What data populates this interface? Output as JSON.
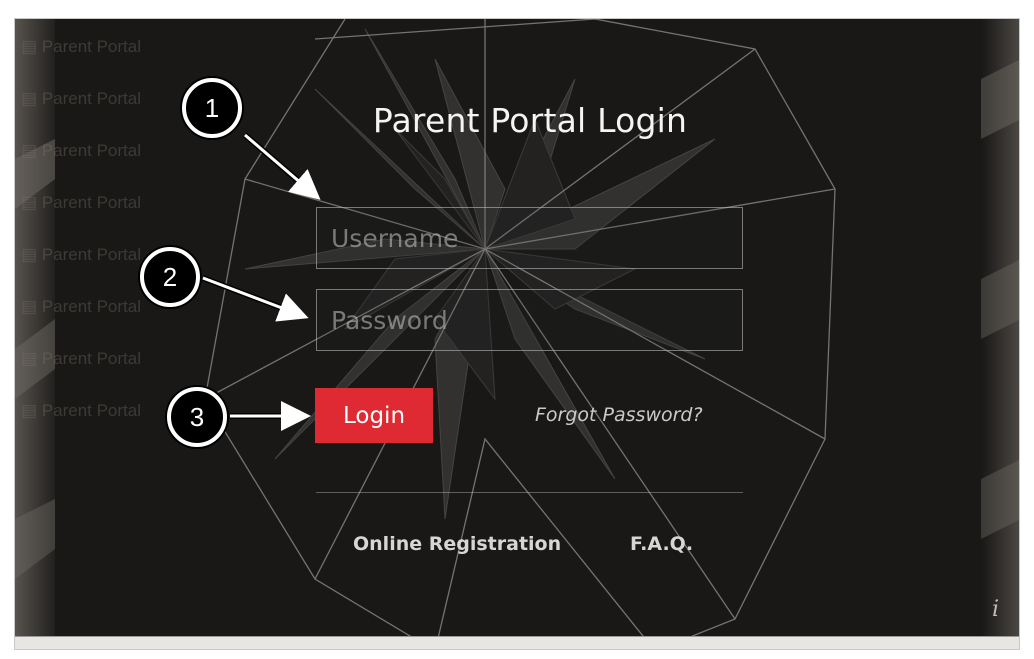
{
  "login_panel": {
    "title": "Parent Portal Login",
    "username_placeholder": "Username",
    "password_placeholder": "Password",
    "login_label": "Login",
    "forgot_label": "Forgot Password?",
    "links": {
      "registration": "Online Registration",
      "faq": "F.A.Q."
    },
    "info_glyph": "i"
  },
  "callouts": {
    "one": "1",
    "two": "2",
    "three": "3"
  },
  "colors": {
    "login_button": "#e02a33",
    "background": "#1e1d1c",
    "callout_badge": "#000000"
  },
  "icons": {
    "info": "info-icon"
  }
}
